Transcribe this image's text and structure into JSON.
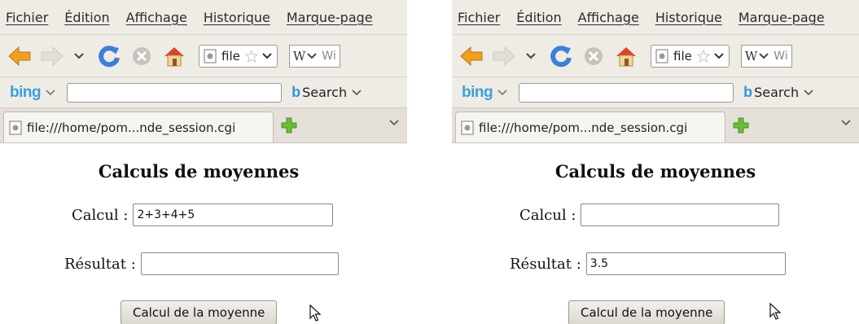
{
  "windows": [
    {
      "menu": [
        "Fichier",
        "Édition",
        "Affichage",
        "Historique",
        "Marque-page"
      ],
      "url_short": "file",
      "search_engine_label": "W",
      "search_engine_trail": "Wi",
      "bing_label": "bing",
      "bing_search_label": "Search",
      "tab_title": "file:///home/pom...nde_session.cgi",
      "page_title": "Calculs de moyennes",
      "calcul_label": "Calcul :",
      "calcul_value": "2+3+4+5",
      "resultat_label": "Résultat :",
      "resultat_value": "",
      "button_label": "Calcul de la moyenne"
    },
    {
      "menu": [
        "Fichier",
        "Édition",
        "Affichage",
        "Historique",
        "Marque-page"
      ],
      "url_short": "file",
      "search_engine_label": "W",
      "search_engine_trail": "Wi",
      "bing_label": "bing",
      "bing_search_label": "Search",
      "tab_title": "file:///home/pom...nde_session.cgi",
      "page_title": "Calculs de moyennes",
      "calcul_label": "Calcul :",
      "calcul_value": "",
      "resultat_label": "Résultat :",
      "resultat_value": "3.5",
      "button_label": "Calcul de la moyenne"
    }
  ],
  "colors": {
    "chrome_bg": "#efece6",
    "back_arrow": "#f0a020",
    "reload": "#3d7fd6",
    "stop": "#c6c3bd",
    "home": "#d8472b",
    "bing": "#3aa0d8",
    "new_tab": "#6dbb3a"
  },
  "icons": [
    "back-arrow-icon",
    "forward-arrow-icon",
    "history-dropdown-icon",
    "reload-icon",
    "stop-icon",
    "home-icon",
    "page-icon",
    "star-icon",
    "new-tab-icon",
    "cursor-icon"
  ]
}
